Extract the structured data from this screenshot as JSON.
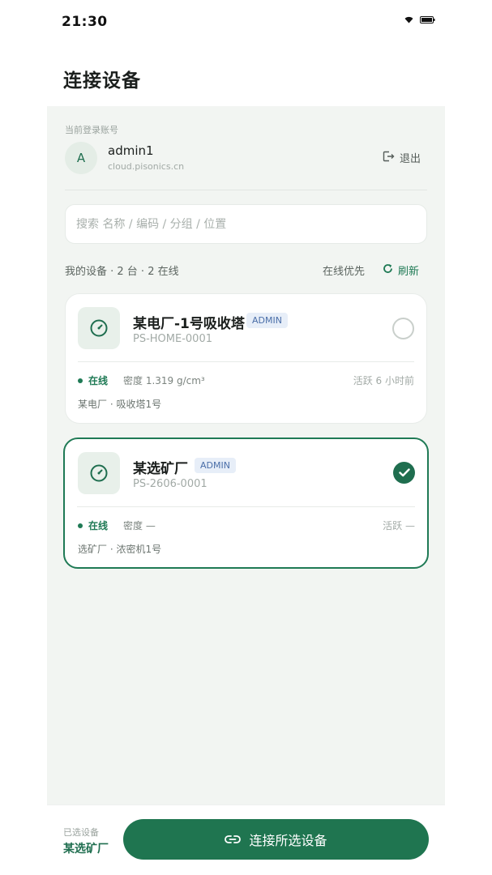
{
  "status_bar": {
    "time": "21:30",
    "icons": [
      "wifi-icon",
      "battery-icon"
    ]
  },
  "page": {
    "title": "连接设备"
  },
  "account": {
    "caption": "当前登录账号",
    "avatar_letter": "A",
    "name": "admin1",
    "host": "cloud.pisonics.cn",
    "logout_label": "退出",
    "logout_icon": "logout-icon"
  },
  "search": {
    "placeholder": "搜索 名称 / 编码 / 分组 / 位置",
    "value": ""
  },
  "list": {
    "summary": "我的设备 · 2 台 · 2 在线",
    "sort_label": "在线优先",
    "refresh_label": "刷新",
    "refresh_icon": "refresh-icon"
  },
  "devices": [
    {
      "name": "某电厂-1号吸收塔",
      "role": "ADMIN",
      "code": "PS-HOME-0001",
      "status": "在线",
      "density": "密度 1.319 g/cm³",
      "active": "活跃 6 小时前",
      "location": "某电厂 · 吸收塔1号",
      "selected": false,
      "icon": "gauge-icon"
    },
    {
      "name": "某选矿厂",
      "role": "ADMIN",
      "code": "PS-2606-0001",
      "status": "在线",
      "density": "密度 —",
      "active": "活跃 —",
      "location": "选矿厂 · 浓密机1号",
      "selected": true,
      "icon": "gauge-icon"
    }
  ],
  "footer": {
    "selected_caption": "已选设备",
    "selected_value": "某选矿厂",
    "connect_label": "连接所选设备",
    "connect_icon": "link-icon"
  },
  "colors": {
    "accent": "#1f7550",
    "panel": "#f2f5f2",
    "badge_bg": "#e7eef8",
    "badge_text": "#4a6ea8"
  }
}
